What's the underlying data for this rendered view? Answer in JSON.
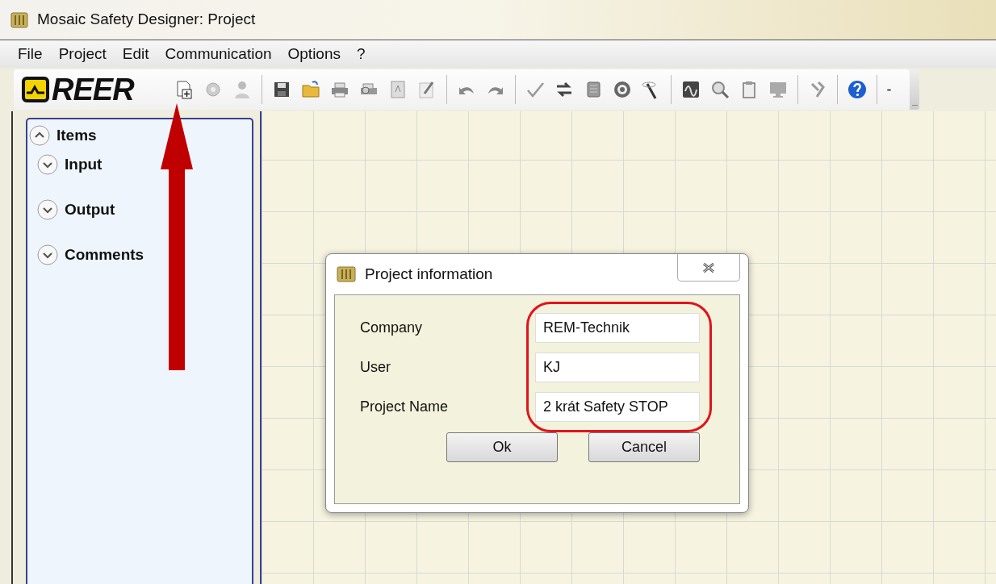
{
  "window": {
    "title": "Mosaic Safety Designer: Project"
  },
  "menu": [
    "File",
    "Project",
    "Edit",
    "Communication",
    "Options",
    "?"
  ],
  "toolbar": {
    "logo": "REER",
    "overflow": "-"
  },
  "sidebar": {
    "items": [
      {
        "label": "Items",
        "expanded": true,
        "children": [
          {
            "label": "Input",
            "expanded": false
          },
          {
            "label": "Output",
            "expanded": false
          },
          {
            "label": "Comments",
            "expanded": false
          }
        ]
      }
    ]
  },
  "dialog": {
    "title": "Project information",
    "fields": [
      {
        "label": "Company",
        "value": "REM-Technik"
      },
      {
        "label": "User",
        "value": "KJ"
      },
      {
        "label": "Project Name",
        "value": "2 krát Safety STOP"
      }
    ],
    "buttons": [
      "Ok",
      "Cancel"
    ]
  }
}
